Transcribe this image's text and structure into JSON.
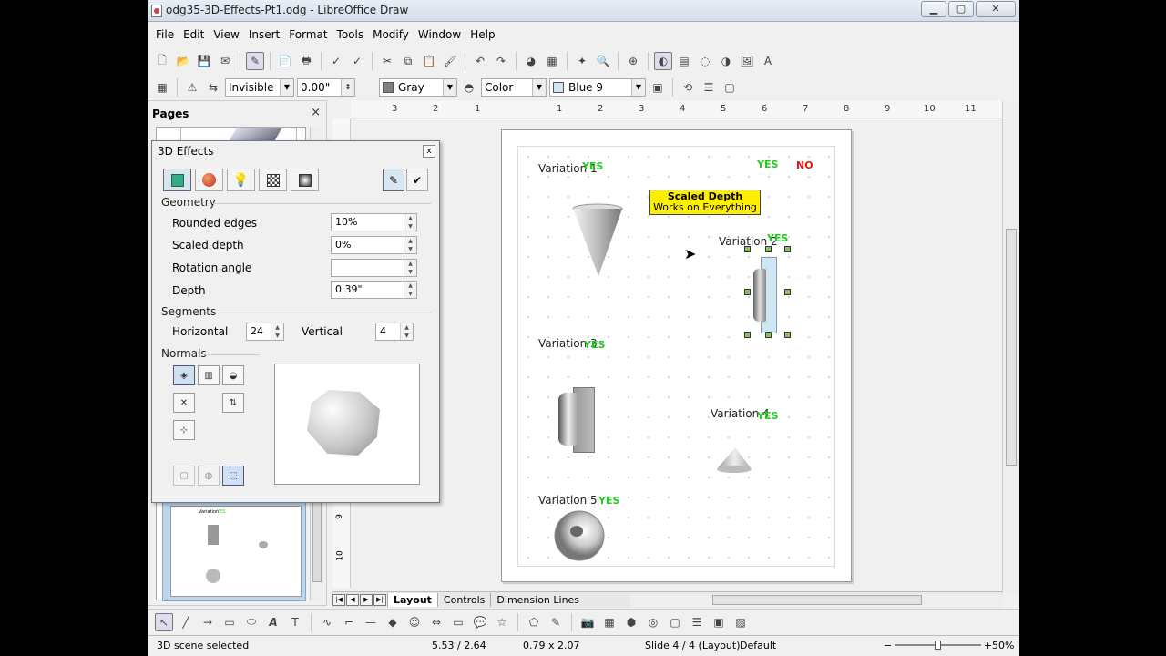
{
  "window": {
    "title": "odg35-3D-Effects-Pt1.odg - LibreOffice Draw",
    "minimize": "▁",
    "maximize": "▢",
    "close": "✕"
  },
  "menu": [
    "File",
    "Edit",
    "View",
    "Insert",
    "Format",
    "Tools",
    "Modify",
    "Window",
    "Help"
  ],
  "toolbar2": {
    "line_style": "Invisible",
    "line_width": "0.00\"",
    "line_color": "Gray",
    "line_color_hex": "#808080",
    "area_style": "Color",
    "area_color": "Blue 9",
    "area_color_hex": "#cfe7f5"
  },
  "pages_panel": {
    "title": "Pages",
    "close": "×",
    "thumb_labels": [
      "Variation",
      "YES"
    ]
  },
  "dialog": {
    "title": "3D Effects",
    "close": "x",
    "geometry_label": "Geometry",
    "rounded_edges_label": "Rounded edges",
    "rounded_edges_value": "10%",
    "scaled_depth_label": "Scaled depth",
    "scaled_depth_value": "0%",
    "rotation_angle_label": "Rotation angle",
    "rotation_angle_value": "",
    "depth_label": "Depth",
    "depth_value": "0.39\"",
    "segments_label": "Segments",
    "horizontal_label": "Horizontal",
    "horizontal_value": "24",
    "vertical_label": "Vertical",
    "vertical_value": "4",
    "normals_label": "Normals"
  },
  "ruler": {
    "ticks": [
      "3",
      "2",
      "1",
      "1",
      "2",
      "3",
      "4",
      "5",
      "6",
      "7",
      "8",
      "9",
      "10",
      "11"
    ],
    "vticks": [
      "9",
      "10"
    ]
  },
  "slide": {
    "variations": [
      "Variation 1",
      "Variation 2",
      "Variation 3",
      "Variation 4",
      "Variation 5"
    ],
    "yes": "YES",
    "no": "NO",
    "callout_line1": "Scaled Depth",
    "callout_line2": "Works on Everything",
    "yes_color": "#22cc22",
    "no_color": "#ee1111",
    "callout_color": "#ffee00"
  },
  "tabs": [
    "Layout",
    "Controls",
    "Dimension Lines"
  ],
  "status": {
    "selection": "3D scene selected",
    "position": "5.53 / 2.64",
    "size": "0.79 x 2.07",
    "slide": "Slide 4 / 4 (Layout)",
    "master": "Default",
    "zoom": "50%",
    "zoom_minus": "−",
    "zoom_plus": "+"
  }
}
